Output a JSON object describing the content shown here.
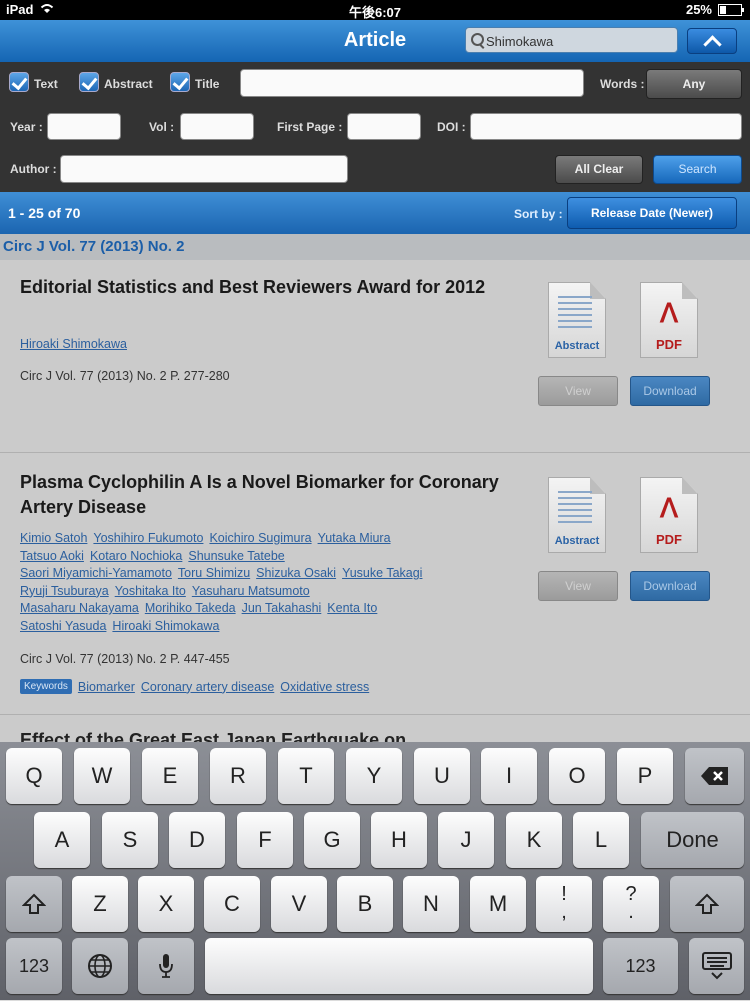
{
  "status": {
    "device": "iPad",
    "time": "午後6:07",
    "battery": "25%",
    "battery_level": 0.25
  },
  "nav": {
    "title": "Article",
    "search_value": "Shimokawa"
  },
  "filters": {
    "text_label": "Text",
    "abstract_label": "Abstract",
    "title_label": "Title",
    "words_label": "Words :",
    "words_value": "Any",
    "year_label": "Year :",
    "vol_label": "Vol :",
    "first_page_label": "First Page :",
    "doi_label": "DOI :",
    "author_label": "Author :",
    "clear_label": "All Clear",
    "search_label": "Search"
  },
  "results": {
    "count": "1 - 25 of 70",
    "sort_label": "Sort by :",
    "sort_value": "Release Date (Newer)"
  },
  "issue_header": "Circ J Vol. 77 (2013) No. 2",
  "articles": [
    {
      "title": "Editorial Statistics and Best Reviewers Award for 2012",
      "authors": [
        "Hiroaki Shimokawa"
      ],
      "citation": "Circ J Vol. 77 (2013) No. 2 P. 277-280",
      "abstract_icon_label": "Abstract",
      "pdf_icon_label": "PDF",
      "view_label": "View",
      "download_label": "Download"
    },
    {
      "title": "Plasma Cyclophilin A Is a Novel Biomarker for Coronary Artery Disease",
      "authors": [
        "Kimio Satoh",
        "Yoshihiro Fukumoto",
        "Koichiro Sugimura",
        "Yutaka Miura",
        "Tatsuo Aoki",
        "Kotaro Nochioka",
        "Shunsuke Tatebe",
        "Saori Miyamichi-Yamamoto",
        "Toru Shimizu",
        "Shizuka Osaki",
        "Yusuke Takagi",
        "Ryuji Tsuburaya",
        "Yoshitaka Ito",
        "Yasuharu Matsumoto",
        "Masaharu Nakayama",
        "Morihiko Takeda",
        "Jun Takahashi",
        "Kenta Ito",
        "Satoshi Yasuda",
        "Hiroaki Shimokawa"
      ],
      "citation": "Circ J Vol. 77 (2013) No. 2 P. 447-455",
      "keywords_label": "Keywords",
      "keywords": [
        "Biomarker",
        "Coronary artery disease",
        "Oxidative stress"
      ],
      "abstract_icon_label": "Abstract",
      "pdf_icon_label": "PDF",
      "view_label": "View",
      "download_label": "Download"
    }
  ],
  "partial_title": "Effect of the Great East Japan Earthquake on",
  "keyboard": {
    "row1": [
      "Q",
      "W",
      "E",
      "R",
      "T",
      "Y",
      "U",
      "I",
      "O",
      "P"
    ],
    "row2": [
      "A",
      "S",
      "D",
      "F",
      "G",
      "H",
      "J",
      "K",
      "L"
    ],
    "row3": [
      "Z",
      "X",
      "C",
      "V",
      "B",
      "N",
      "M"
    ],
    "done": "Done",
    "num": "123",
    "excl": "!",
    "comma": ",",
    "question": "?",
    "period": "."
  }
}
